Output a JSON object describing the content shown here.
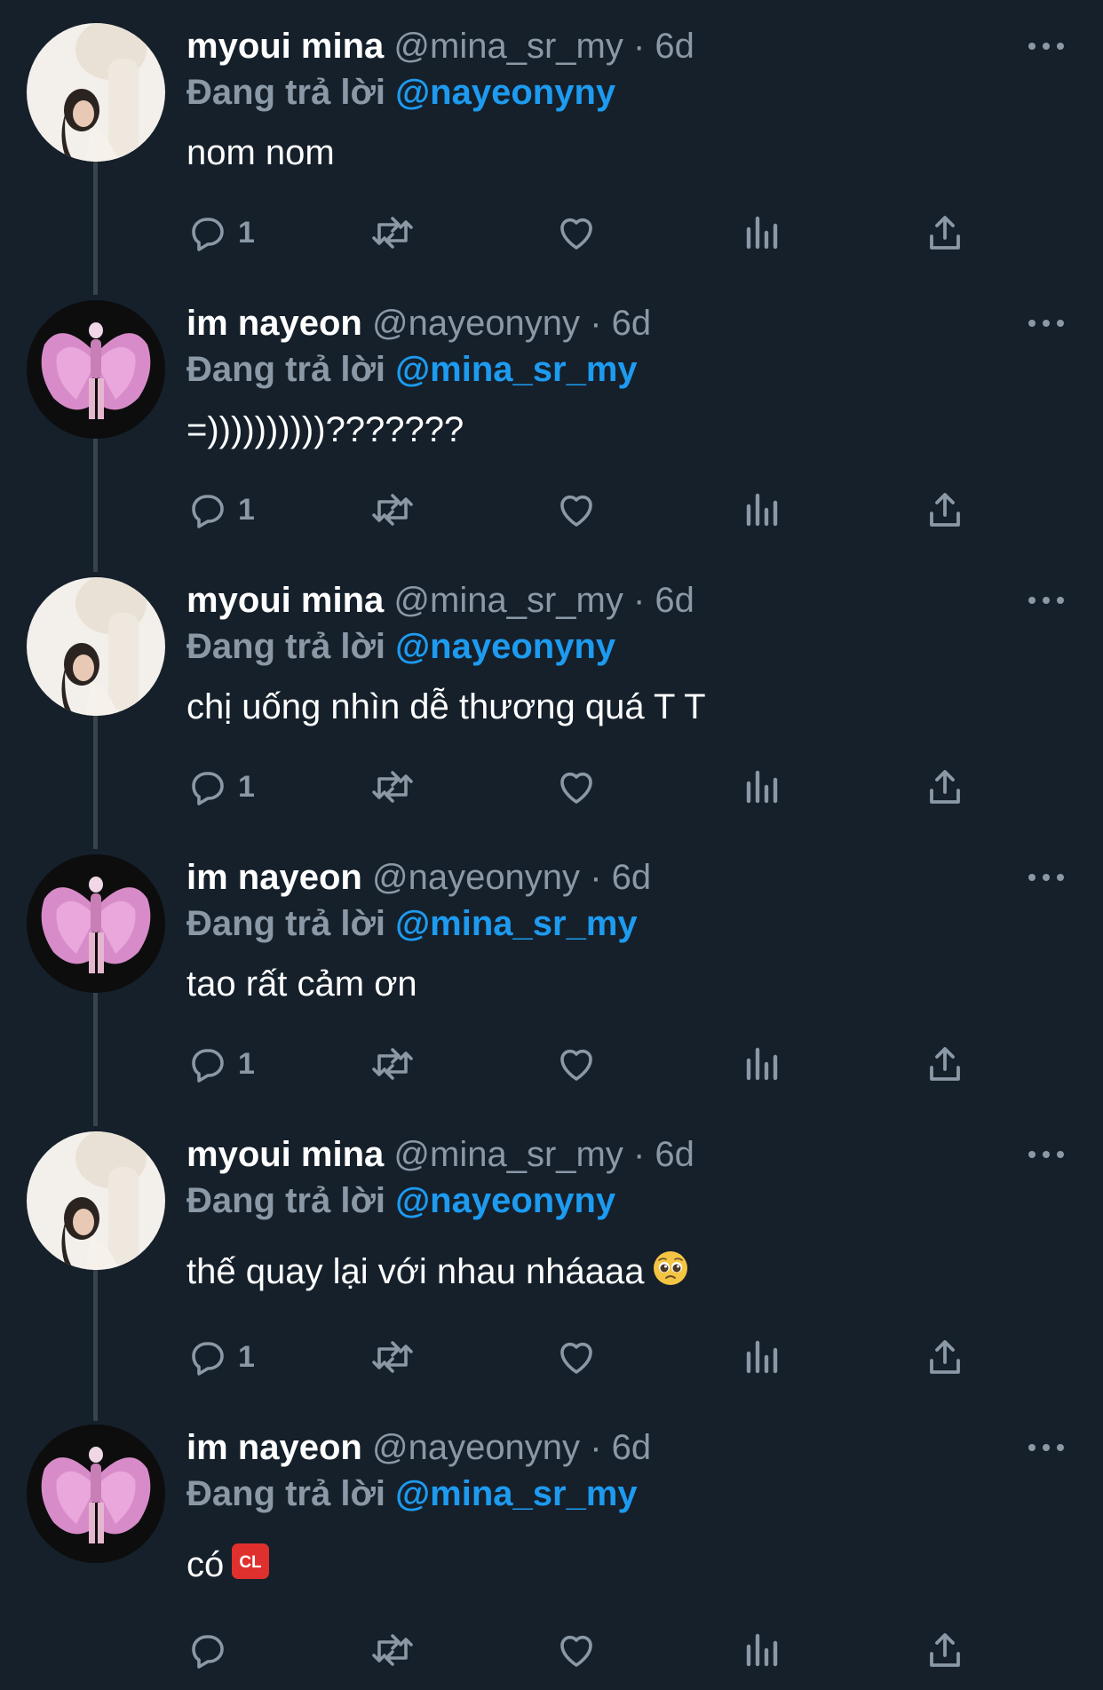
{
  "thread": [
    {
      "display_name": "myoui mina",
      "handle": "@mina_sr_my",
      "separator": "·",
      "time": "6d",
      "reply_prefix": "Đang trả lời",
      "reply_to": "@nayeonyny",
      "text": "nom nom",
      "reply_count": "1",
      "avatar": "mina-avatar",
      "emoji": ""
    },
    {
      "display_name": "im nayeon",
      "handle": "@nayeonyny",
      "separator": "·",
      "time": "6d",
      "reply_prefix": "Đang trả lời",
      "reply_to": "@mina_sr_my",
      "text": "=))))))))))???????",
      "reply_count": "1",
      "avatar": "nayeon-avatar",
      "emoji": ""
    },
    {
      "display_name": "myoui mina",
      "handle": "@mina_sr_my",
      "separator": "·",
      "time": "6d",
      "reply_prefix": "Đang trả lời",
      "reply_to": "@nayeonyny",
      "text": "chị uống nhìn dễ thương quá T T",
      "reply_count": "1",
      "avatar": "mina-avatar",
      "emoji": ""
    },
    {
      "display_name": "im nayeon",
      "handle": "@nayeonyny",
      "separator": "·",
      "time": "6d",
      "reply_prefix": "Đang trả lời",
      "reply_to": "@mina_sr_my",
      "text": "tao rất cảm ơn",
      "reply_count": "1",
      "avatar": "nayeon-avatar",
      "emoji": ""
    },
    {
      "display_name": "myoui mina",
      "handle": "@mina_sr_my",
      "separator": "·",
      "time": "6d",
      "reply_prefix": "Đang trả lời",
      "reply_to": "@nayeonyny",
      "text": "thế quay lại với nhau nháaaa",
      "reply_count": "1",
      "avatar": "mina-avatar",
      "emoji": "pleading-face-emoji"
    },
    {
      "display_name": "im nayeon",
      "handle": "@nayeonyny",
      "separator": "·",
      "time": "6d",
      "reply_prefix": "Đang trả lời",
      "reply_to": "@mina_sr_my",
      "text": "có",
      "reply_count": "",
      "avatar": "nayeon-avatar",
      "emoji": "cl-button-emoji",
      "emoji_text": "CL"
    }
  ],
  "icons": {
    "reply": "reply-icon",
    "retweet": "retweet-icon",
    "like": "like-icon",
    "views": "views-icon",
    "share": "share-icon",
    "more": "more-icon"
  },
  "colors": {
    "background": "#15202b",
    "text": "#ffffff",
    "muted": "#8b98a5",
    "accent": "#1d9bf0",
    "thread_line": "#38444d"
  }
}
